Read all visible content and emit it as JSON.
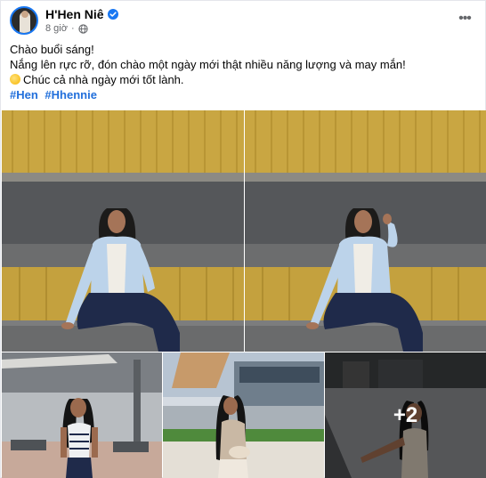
{
  "post": {
    "author": "H'Hen Niê",
    "time": "8 giờ",
    "lines": [
      "Chào buổi sáng!",
      "Nắng lên rực rỡ, đón chào một ngày mới thật nhiều năng lượng và may mắn!",
      "Chúc cả nhà ngày mới tốt lành."
    ],
    "hashtags": [
      "#Hen",
      "#Hhennie"
    ],
    "more_photos": "+2"
  },
  "icons": {
    "verified": "verified-badge-icon",
    "privacy": "globe-icon",
    "menu": "more-options-icon",
    "sun": "sun-emoji-icon"
  },
  "colors": {
    "accent": "#1877f2",
    "hashtag": "#216fdb",
    "secondary_text": "#65676b"
  }
}
